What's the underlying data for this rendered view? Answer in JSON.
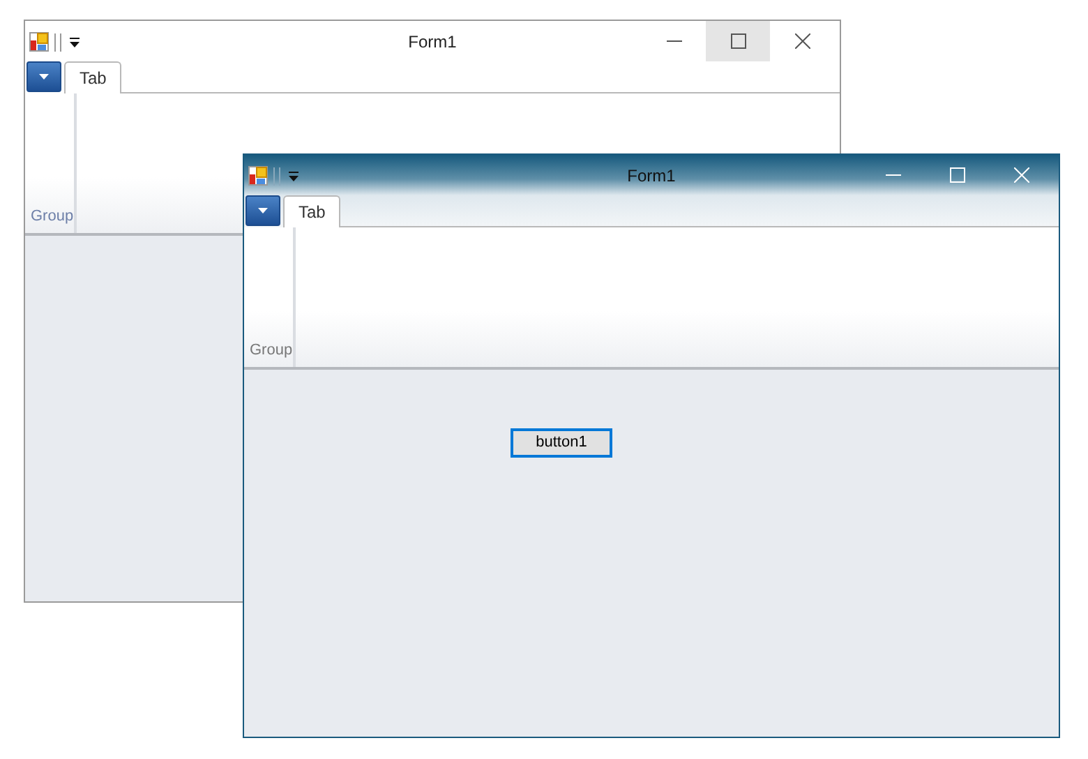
{
  "windows": [
    {
      "title": "Form1",
      "active": false,
      "tab": {
        "label": "Tab",
        "selected": true
      },
      "group": "Group",
      "maximize_hovered": true
    },
    {
      "title": "Form1",
      "active": true,
      "tab": {
        "label": "Tab",
        "selected": true
      },
      "group": "Group",
      "maximize_hovered": false,
      "buttons": [
        {
          "label": "button1",
          "focused": true
        }
      ]
    }
  ]
}
